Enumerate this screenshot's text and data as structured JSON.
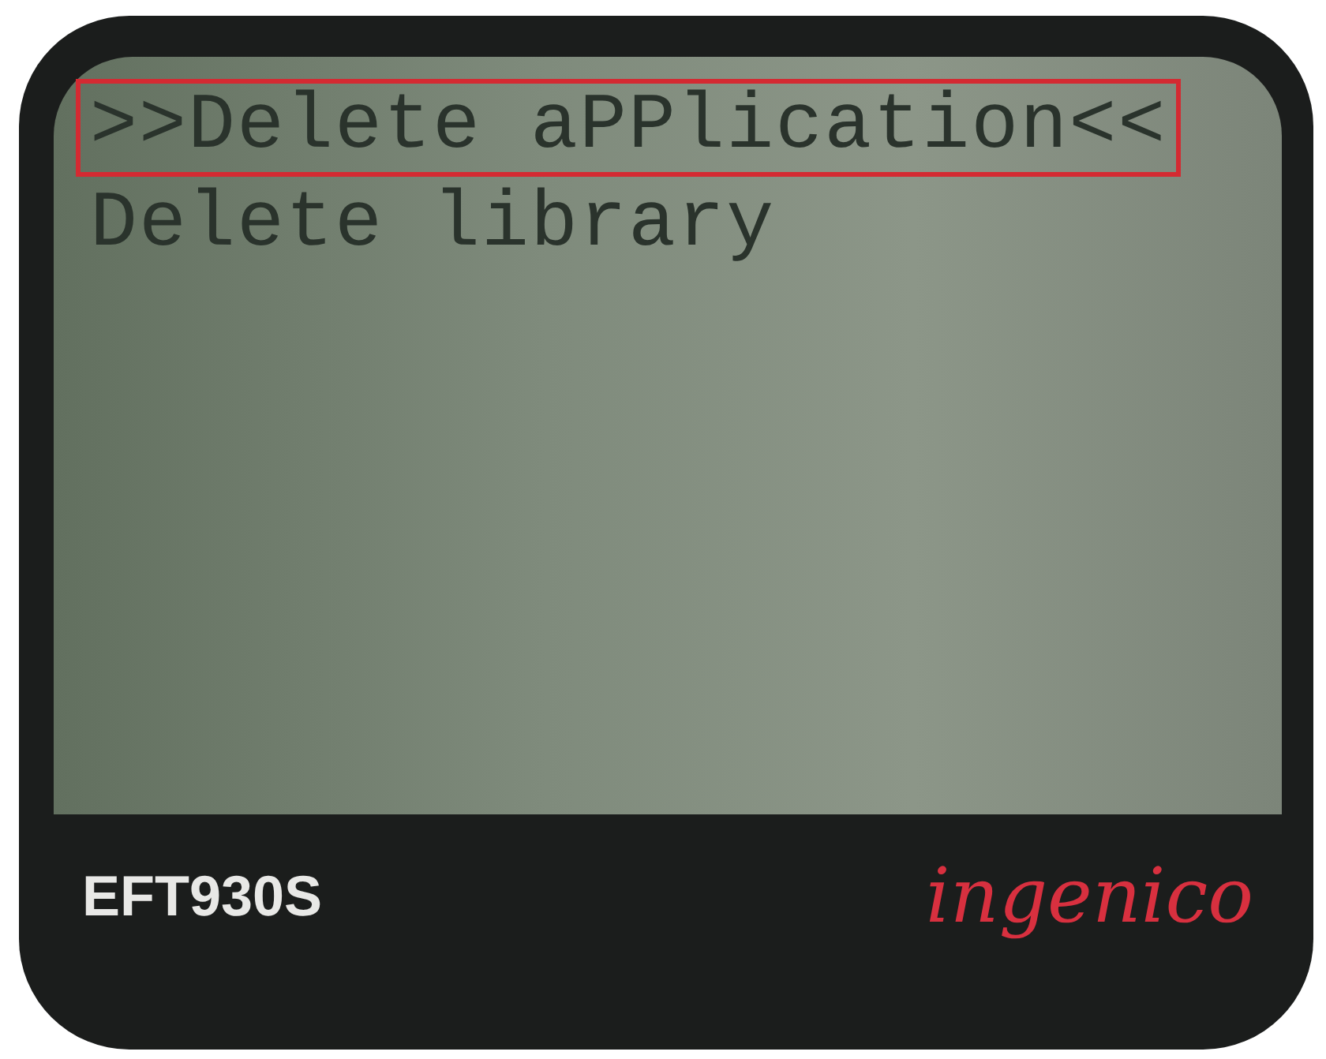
{
  "menu": {
    "items": [
      {
        "label": ">>Delete aPPlication<<",
        "selected": true
      },
      {
        "label": "Delete library",
        "selected": false
      }
    ]
  },
  "device": {
    "model": "EFT930S",
    "brand": "ingenico"
  }
}
